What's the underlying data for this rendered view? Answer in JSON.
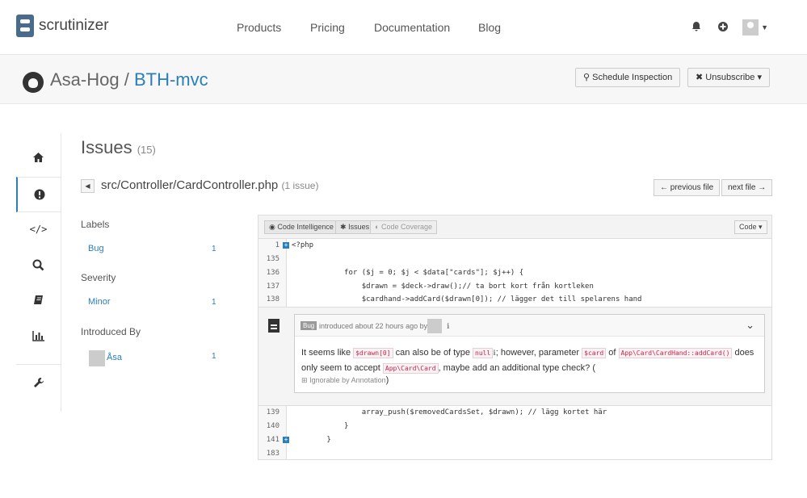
{
  "header": {
    "brand": "scrutinizer",
    "nav": [
      "Products",
      "Pricing",
      "Documentation",
      "Blog"
    ]
  },
  "repo": {
    "owner": "Asa-Hog",
    "separator": "/",
    "name": "BTH-mvc",
    "schedule_label": "Schedule Inspection",
    "unsubscribe_label": "Unsubscribe"
  },
  "issues": {
    "title": "Issues",
    "count": "(15)",
    "file": "src/Controller/CardController.php",
    "file_issue_count": "(1 issue)",
    "prev_label": "← previous file",
    "next_label": "next file →"
  },
  "filters": {
    "labels_heading": "Labels",
    "labels": [
      {
        "name": "Bug",
        "count": "1"
      }
    ],
    "severity_heading": "Severity",
    "severity": [
      {
        "name": "Minor",
        "count": "1"
      }
    ],
    "introduced_heading": "Introduced By",
    "introduced": [
      {
        "name": "Åsa",
        "count": "1"
      }
    ]
  },
  "code_toolbar": {
    "intel": "Code Intelligence",
    "issues": "Issues",
    "coverage": "Code Coverage",
    "mode": "Code"
  },
  "code_lines": [
    {
      "ln": "1",
      "code": "<?php"
    },
    {
      "ln": "135",
      "code": ""
    },
    {
      "ln": "136",
      "code": "            for ($j = 0; $j < $data[\"cards\"]; $j++) {"
    },
    {
      "ln": "137",
      "code": "                $drawn = $deck->draw();// ta bort kort från kortleken"
    },
    {
      "ln": "138",
      "code": "                $cardhand->addCard($drawn[0]); // lägger det till spelarens hand"
    },
    {
      "ln": "139",
      "code": "                array_push($removedCardsSet, $drawn); // lägg kortet här"
    },
    {
      "ln": "140",
      "code": "            }"
    },
    {
      "ln": "141",
      "code": "        }"
    },
    {
      "ln": "183",
      "code": ""
    }
  ],
  "issue": {
    "badge": "Bug",
    "meta": "introduced about 22 hours ago by",
    "text_1": "It seems like",
    "tag_1": "$drawn[0]",
    "text_2": "can also be of type",
    "tag_2": "null",
    "text_3": "; however, parameter",
    "tag_3": "$card",
    "text_4": "of",
    "tag_4": "App\\Card\\CardHand::addCard()",
    "text_5": "does only seem to accept",
    "tag_5": "App\\Card\\Card",
    "text_6": ", maybe add an additional type check? (",
    "ignorable": "Ignorable by Annotation",
    "ignorable_close": ")"
  }
}
